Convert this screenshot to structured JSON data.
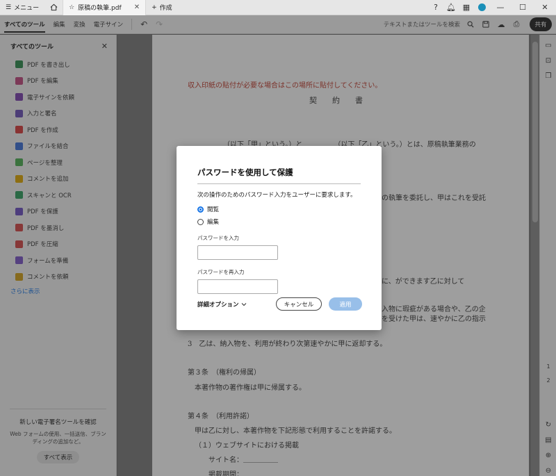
{
  "titlebar": {
    "menu_label": "メニュー",
    "tab_title": "原稿の執筆.pdf",
    "new_tab_label": "作成"
  },
  "toolbar": {
    "tabs": [
      {
        "label": "すべてのツール"
      },
      {
        "label": "編集"
      },
      {
        "label": "変換"
      },
      {
        "label": "電子サイン"
      }
    ],
    "search_hint": "テキストまたはツールを検索",
    "share_label": "共有"
  },
  "left_panel": {
    "title": "すべてのツール",
    "items": [
      {
        "label": "PDF を書き出し",
        "color": "#2d8a4e"
      },
      {
        "label": "PDF を編集",
        "color": "#c2477e"
      },
      {
        "label": "電子サインを依頼",
        "color": "#7b3fb0"
      },
      {
        "label": "入力と署名",
        "color": "#6b4fb8"
      },
      {
        "label": "PDF を作成",
        "color": "#d93b3b"
      },
      {
        "label": "ファイルを結合",
        "color": "#3b6fd9"
      },
      {
        "label": "ページを整理",
        "color": "#4caf50"
      },
      {
        "label": "コメントを追加",
        "color": "#e0a800"
      },
      {
        "label": "スキャンと OCR",
        "color": "#2e9e5e"
      },
      {
        "label": "PDF を保護",
        "color": "#6c4fc4"
      },
      {
        "label": "PDF を墨消し",
        "color": "#d64545"
      },
      {
        "label": "PDF を圧縮",
        "color": "#d64545"
      },
      {
        "label": "フォームを準備",
        "color": "#7a55c9"
      },
      {
        "label": "コメントを依頼",
        "color": "#d4a017"
      }
    ],
    "more_label": "さらに表示",
    "promo": {
      "title": "新しい電子署名ツールを確認",
      "body": "Web フォームの使用、一括送信、ブランディングの追加など。",
      "button": "すべて表示"
    }
  },
  "document": {
    "lines": [
      {
        "text": "収入印紙の貼付が必要な場合はこの場所に貼付してください。",
        "red": true
      },
      {
        "text": "契約書",
        "title": true
      },
      {
        "text": "（以下「甲」という。）と　　　　　（以下「乙」という。）とは、原稿執筆業務の"
      },
      {
        "text": "の執筆を委託し、甲はこれを受託"
      },
      {
        "text": "に、ができます乙に対して"
      },
      {
        "text": "入物に瑕疵がある場合や、乙の企"
      },
      {
        "text": "を受けた甲は、速やかに乙の指示"
      },
      {
        "text": "3　乙は、納入物を、利用が終わり次第速やかに甲に返却する。"
      },
      {
        "text": "第３条　（権利の帰属）"
      },
      {
        "text": "本著作物の著作権は甲に帰属する。"
      },
      {
        "text": "第４条　（利用許諾）"
      },
      {
        "text": "甲は乙に対し、本著作物を下記形態で利用することを許諾する。"
      },
      {
        "text": "（１）ウェブサイトにおける掲載"
      },
      {
        "text": "サイト名：＿＿＿＿＿"
      },
      {
        "text": "掲載期間："
      }
    ]
  },
  "right_rail": {
    "page_numbers": [
      "1",
      "2"
    ]
  },
  "dialog": {
    "title": "パスワードを使用して保護",
    "description": "次の操作のためのパスワード入力をユーザーに要求します。",
    "options": [
      {
        "label": "閲覧",
        "checked": true
      },
      {
        "label": "編集",
        "checked": false
      }
    ],
    "password_label": "パスワードを入力",
    "password_value": "",
    "password_confirm_label": "パスワードを再入力",
    "password_confirm_value": "",
    "advanced_label": "詳細オプション",
    "cancel_label": "キャンセル",
    "apply_label": "適用"
  }
}
